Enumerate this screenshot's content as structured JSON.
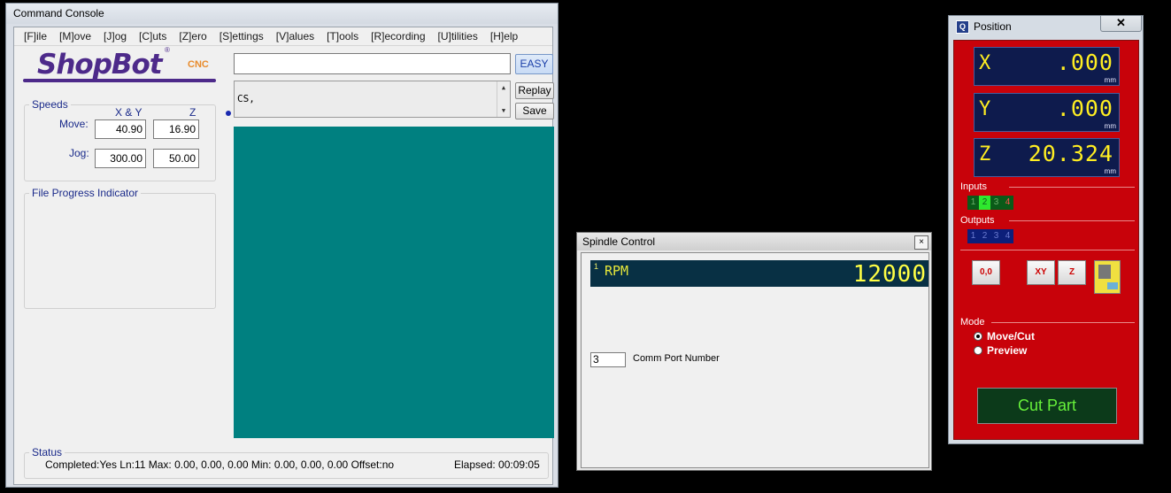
{
  "console": {
    "title": "Command Console",
    "menu": [
      "[F]ile",
      "[M]ove",
      "[J]og",
      "[C]uts",
      "[Z]ero",
      "[S]ettings",
      "[V]alues",
      "[T]ools",
      "[R]ecording",
      "[U]tilities",
      "[H]elp"
    ],
    "logo_text": "ShopBot",
    "logo_reg": "®",
    "logo_cnc": "CNC",
    "easy_label": "EASY",
    "replay_label": "Replay",
    "save_label": "Save",
    "command_value": "",
    "history_text": "CS,",
    "speeds": {
      "legend": "Speeds",
      "col_xy": "X & Y",
      "col_z": "Z",
      "move_label": "Move:",
      "jog_label": "Jog:",
      "move_xy": "40.90",
      "move_z": "16.90",
      "jog_xy": "300.00",
      "jog_z": "50.00"
    },
    "progress_legend": "File Progress Indicator",
    "status": {
      "legend": "Status",
      "text": "Completed:Yes Ln:11 Max: 0.00, 0.00, 0.00  Min: 0.00, 0.00, 0.00  Offset:no",
      "elapsed": "Elapsed: 00:09:05"
    },
    "colors": {
      "preview": "#008080",
      "logo": "#4d2a8a",
      "cnc": "#e88a2a"
    }
  },
  "spindle": {
    "title": "Spindle Control",
    "close": "×",
    "index": "1",
    "rpm_label": "RPM",
    "rpm_value": "12000",
    "port_value": "3",
    "port_label": "Comm Port Number"
  },
  "position": {
    "title": "Position",
    "close": "✕",
    "icon_letter": "Q",
    "axes": [
      {
        "axis": "X",
        "value": ".000",
        "unit": "mm"
      },
      {
        "axis": "Y",
        "value": ".000",
        "unit": "mm"
      },
      {
        "axis": "Z",
        "value": "20.324",
        "unit": "mm"
      }
    ],
    "inputs_label": "Inputs",
    "inputs": [
      {
        "n": "1",
        "state": "off"
      },
      {
        "n": "2",
        "state": "on"
      },
      {
        "n": "3",
        "state": "off"
      },
      {
        "n": "4",
        "state": "alarm"
      }
    ],
    "outputs_label": "Outputs",
    "outputs": [
      "1",
      "2",
      "3",
      "4"
    ],
    "zero_label": "0,0",
    "xy_label": "XY",
    "z_label": "Z",
    "mode_label": "Mode",
    "mode_options": [
      "Move/Cut",
      "Preview"
    ],
    "mode_selected": "Move/Cut",
    "cut_part_label": "Cut Part",
    "colors": {
      "panel": "#c8020a",
      "dro": "#0e1b4d",
      "digits": "#ffee22",
      "cut_text": "#66f03a"
    }
  }
}
